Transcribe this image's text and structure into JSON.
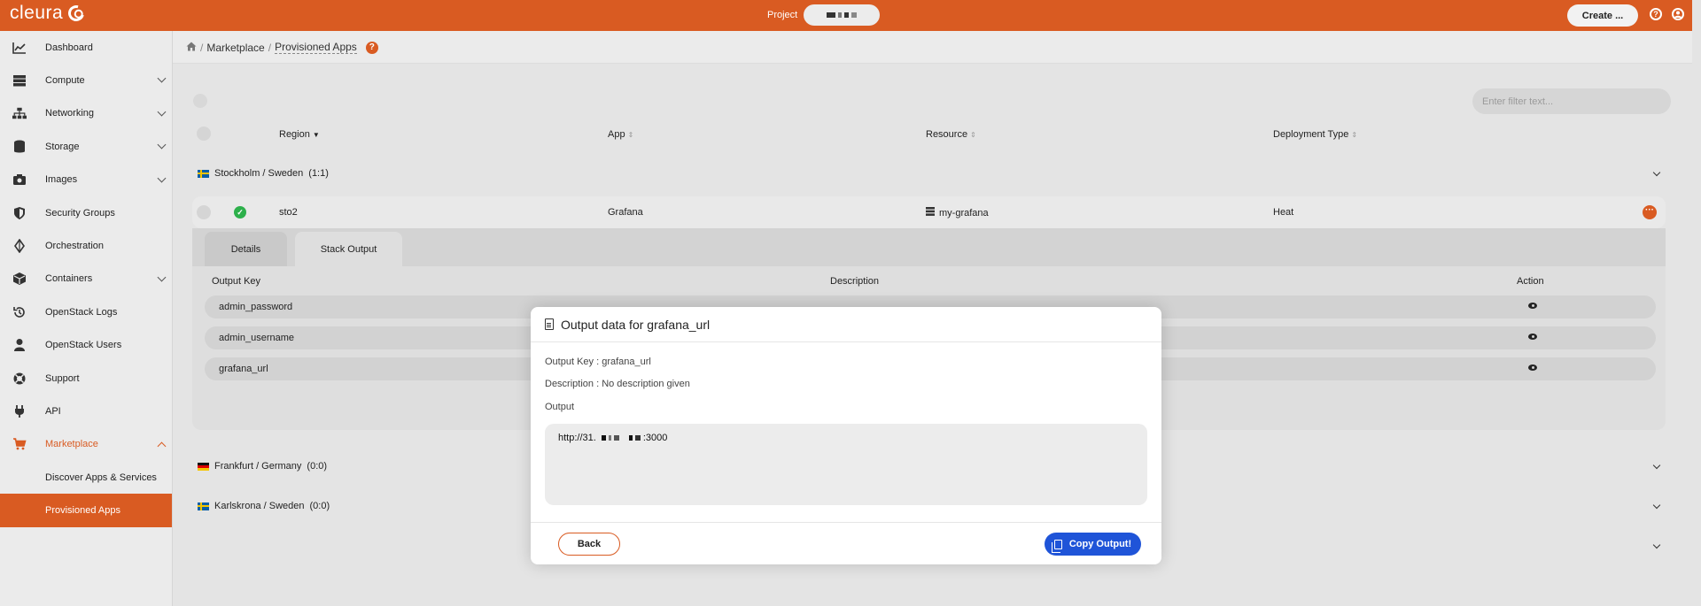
{
  "topbar": {
    "brand": "cleura",
    "project_label": "Project",
    "create_label": "Create ...",
    "help_icon": "help-icon",
    "user_icon": "user-icon"
  },
  "sidebar": {
    "items": [
      {
        "label": "Dashboard",
        "icon": "chart-icon",
        "expandable": false
      },
      {
        "label": "Compute",
        "icon": "server-icon",
        "expandable": true
      },
      {
        "label": "Networking",
        "icon": "network-icon",
        "expandable": true
      },
      {
        "label": "Storage",
        "icon": "database-icon",
        "expandable": true
      },
      {
        "label": "Images",
        "icon": "camera-icon",
        "expandable": true
      },
      {
        "label": "Security Groups",
        "icon": "shield-icon",
        "expandable": false
      },
      {
        "label": "Orchestration",
        "icon": "orchestration-icon",
        "expandable": false
      },
      {
        "label": "Containers",
        "icon": "cube-icon",
        "expandable": true
      },
      {
        "label": "OpenStack Logs",
        "icon": "history-icon",
        "expandable": false
      },
      {
        "label": "OpenStack Users",
        "icon": "user-icon",
        "expandable": false
      },
      {
        "label": "Support",
        "icon": "lifebuoy-icon",
        "expandable": false
      },
      {
        "label": "API",
        "icon": "plug-icon",
        "expandable": false
      },
      {
        "label": "Marketplace",
        "icon": "cart-icon",
        "expandable": true,
        "expanded": true
      }
    ],
    "subitems": [
      {
        "label": "Discover Apps & Services",
        "active": false
      },
      {
        "label": "Provisioned Apps",
        "active": true
      }
    ]
  },
  "breadcrumb": {
    "sep": "/",
    "marketplace": "Marketplace",
    "current": "Provisioned Apps",
    "help": "?"
  },
  "filter": {
    "placeholder": "Enter filter text..."
  },
  "columns": {
    "region": "Region",
    "app": "App",
    "resource": "Resource",
    "deployment_type": "Deployment Type"
  },
  "groups": [
    {
      "name": "Stockholm / Sweden",
      "count": "(1:1)"
    },
    {
      "name": "Frankfurt / Germany",
      "count": "(0:0)"
    },
    {
      "name": "Karlskrona / Sweden",
      "count": "(0:0)"
    }
  ],
  "app_row": {
    "region": "sto2",
    "app": "Grafana",
    "resource": "my-grafana",
    "deployment_type": "Heat",
    "status": "ok"
  },
  "detail_tabs": [
    "Details",
    "Stack Output"
  ],
  "output_table": {
    "col_key": "Output Key",
    "col_desc": "Description",
    "col_action": "Action",
    "rows": [
      "admin_password",
      "admin_username",
      "grafana_url"
    ]
  },
  "modal": {
    "title": "Output data for grafana_url",
    "output_key_line": "Output Key : grafana_url",
    "description_line": "Description : No description given",
    "output_label": "Output",
    "output_prefix": "http://31.",
    "output_suffix": ":3000",
    "back_label": "Back",
    "copy_label": "Copy Output!"
  },
  "colors": {
    "brand": "#d95b22",
    "primary_button": "#1f54d8",
    "success": "#2db04b"
  }
}
